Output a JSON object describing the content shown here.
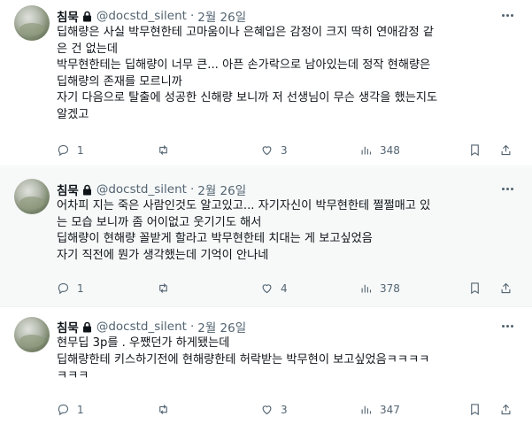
{
  "tweets": [
    {
      "name": "침묵",
      "handle": "@docstd_silent",
      "date": "2월 26일",
      "lines": [
        "딥해량은 사실 박무현한테 고마움이나 은혜입은 감정이 크지 딱히 연애감정 같",
        "은 건 없는데",
        "박무현한테는 딥해량이 너무 큰... 아픈 손가락으로 남아있는데 정작 현해량은",
        "딥해량의 존재를 모르니까",
        "자기 다음으로 탈출에 성공한 신해량 보니까 저 선생님이 무슨 생각을 했는지도",
        "알겠고"
      ],
      "replies": "1",
      "retweets": "",
      "likes": "3",
      "views": "348"
    },
    {
      "name": "침묵",
      "handle": "@docstd_silent",
      "date": "2월 26일",
      "lines": [
        "어차피 지는 죽은 사람인것도 알고있고... 자기자신이 박무현한테 쩔쩔매고 있",
        "는 모습 보니까 좀 어이없고 웃기기도 해서",
        "딥해량이 현해량 꼴받게 할라고 박무현한테 치대는 게 보고싶었음",
        "자기 직전에 뭔가 생각했는데 기억이 안나네"
      ],
      "replies": "1",
      "retweets": "",
      "likes": "4",
      "views": "378"
    },
    {
      "name": "침묵",
      "handle": "@docstd_silent",
      "date": "2월 26일",
      "lines": [
        "현무딥 3p를 . 우쨌던가 하게됐는데",
        "딥해량한테 키스하기전에 현해량한테 허락받는 박무현이 보고싶었음ㅋㅋㅋㅋ",
        "ㅋㅋㅋ"
      ],
      "replies": "1",
      "retweets": "",
      "likes": "3",
      "views": "347"
    }
  ],
  "icons": {
    "lock": "lock-icon",
    "reply": "reply-icon",
    "retweet": "retweet-icon",
    "like": "heart-icon",
    "views": "views-icon",
    "bookmark": "bookmark-icon",
    "share": "share-icon",
    "more": "more-icon"
  },
  "colors": {
    "text": "#0f1419",
    "muted": "#536471",
    "highlight": "#f7f9f9",
    "border": "#eff3f4"
  }
}
